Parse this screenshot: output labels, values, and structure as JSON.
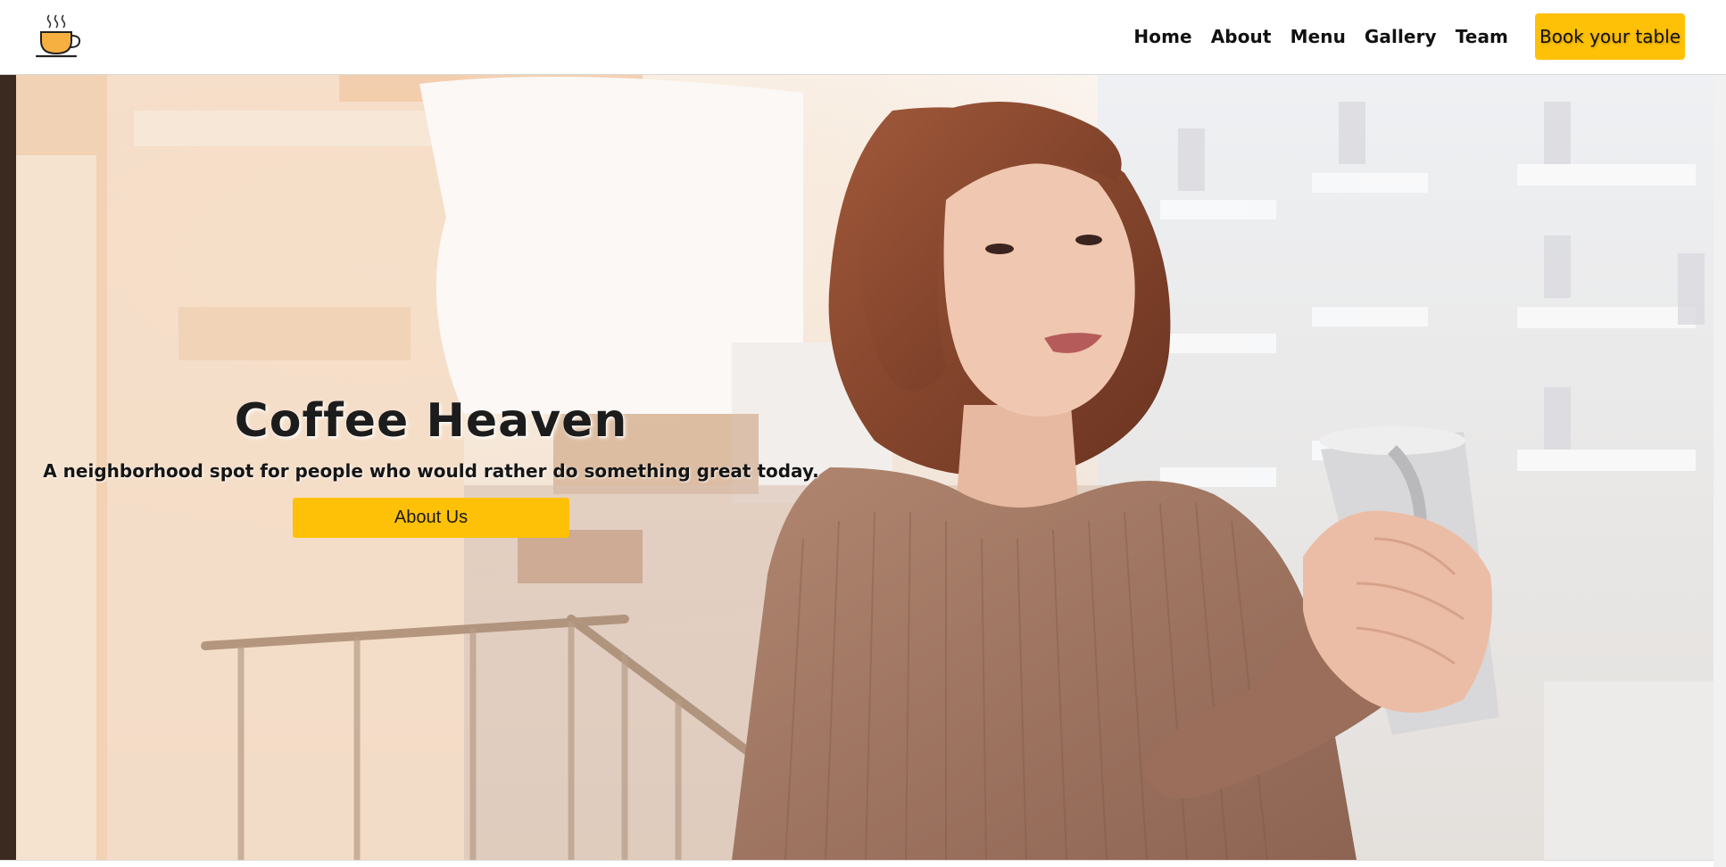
{
  "navbar": {
    "logo_icon": "coffee-cup-icon",
    "links": [
      {
        "label": "Home"
      },
      {
        "label": "About"
      },
      {
        "label": "Menu"
      },
      {
        "label": "Gallery"
      },
      {
        "label": "Team"
      }
    ],
    "cta_label": "Book your table"
  },
  "hero": {
    "title": "Coffee Heaven",
    "subtitle": "A neighborhood spot for people who would rather do something great today.",
    "button_label": "About Us",
    "image": "woman-holding-coffee-cup-on-balcony"
  },
  "colors": {
    "accent": "#ffc107",
    "text": "#111111",
    "navbar_bg": "#ffffff"
  }
}
